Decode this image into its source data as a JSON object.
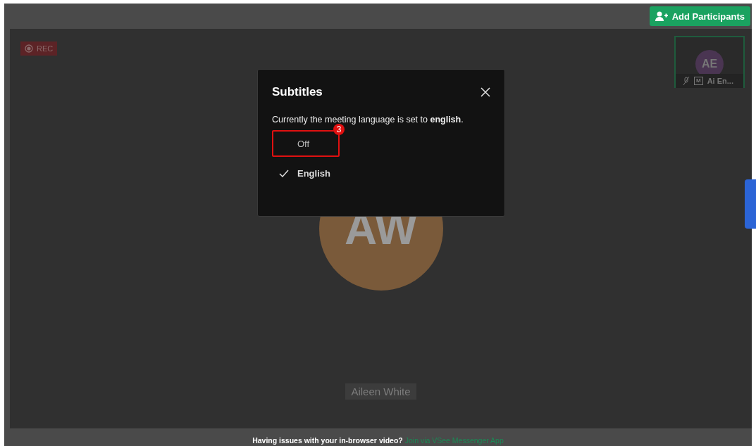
{
  "top_bar": {
    "add_button": "Add Participants"
  },
  "rec_badge": "REC",
  "thumbnail": {
    "initials": "AE",
    "name": "Ai En...",
    "moderator_mark": "M",
    "muted": true
  },
  "speaker": {
    "initials": "AW",
    "name": "Aileen White"
  },
  "dialog": {
    "title": "Subtitles",
    "message": "Currently the meeting language is set to **english**.",
    "options": [
      {
        "label": "Off",
        "checked": false,
        "highlighted": true,
        "step": "3"
      },
      {
        "label": "English",
        "checked": true,
        "highlighted": false
      }
    ]
  },
  "footer": {
    "text": "Having issues with your in-browser video?",
    "link": "Join via VSee Messenger App"
  }
}
